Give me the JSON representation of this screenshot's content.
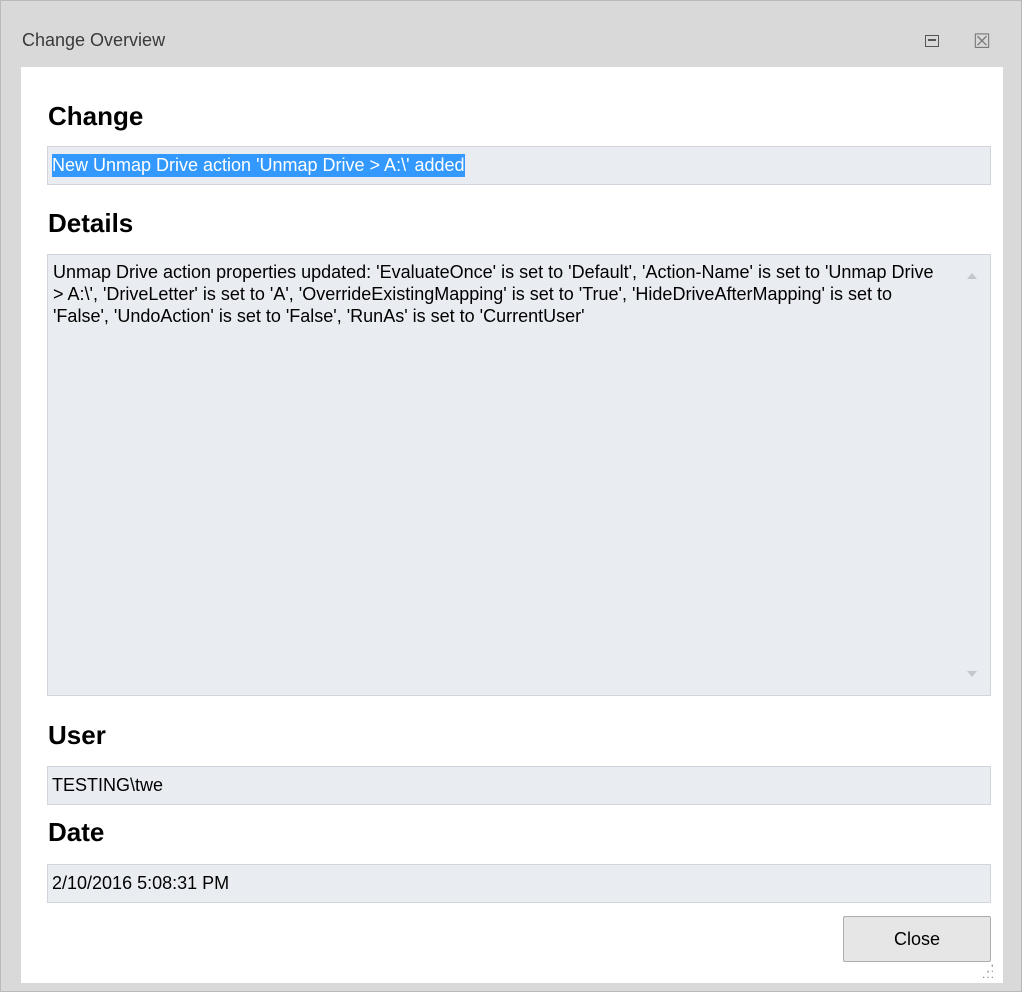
{
  "window": {
    "title": "Change Overview",
    "restore_icon": "restore-icon",
    "close_icon": "close-icon",
    "close_glyph": "☒"
  },
  "change": {
    "label": "Change",
    "value": "New Unmap Drive action 'Unmap Drive > A:\\' added"
  },
  "details": {
    "label": "Details",
    "value": "Unmap Drive action properties updated:  'EvaluateOnce' is set to 'Default', 'Action-Name' is set to 'Unmap Drive > A:\\', 'DriveLetter' is set to 'A', 'OverrideExistingMapping' is set to 'True', 'HideDriveAfterMapping' is set to 'False', 'UndoAction' is set to 'False', 'RunAs' is set to 'CurrentUser'"
  },
  "user": {
    "label": "User",
    "value": "TESTING\\twe"
  },
  "date": {
    "label": "Date",
    "value": "2/10/2016 5:08:31 PM"
  },
  "buttons": {
    "close_label": "Close"
  },
  "colors": {
    "selection": "#3399ff",
    "field_background": "#e9ecf1",
    "chrome": "#d9d9d9"
  }
}
